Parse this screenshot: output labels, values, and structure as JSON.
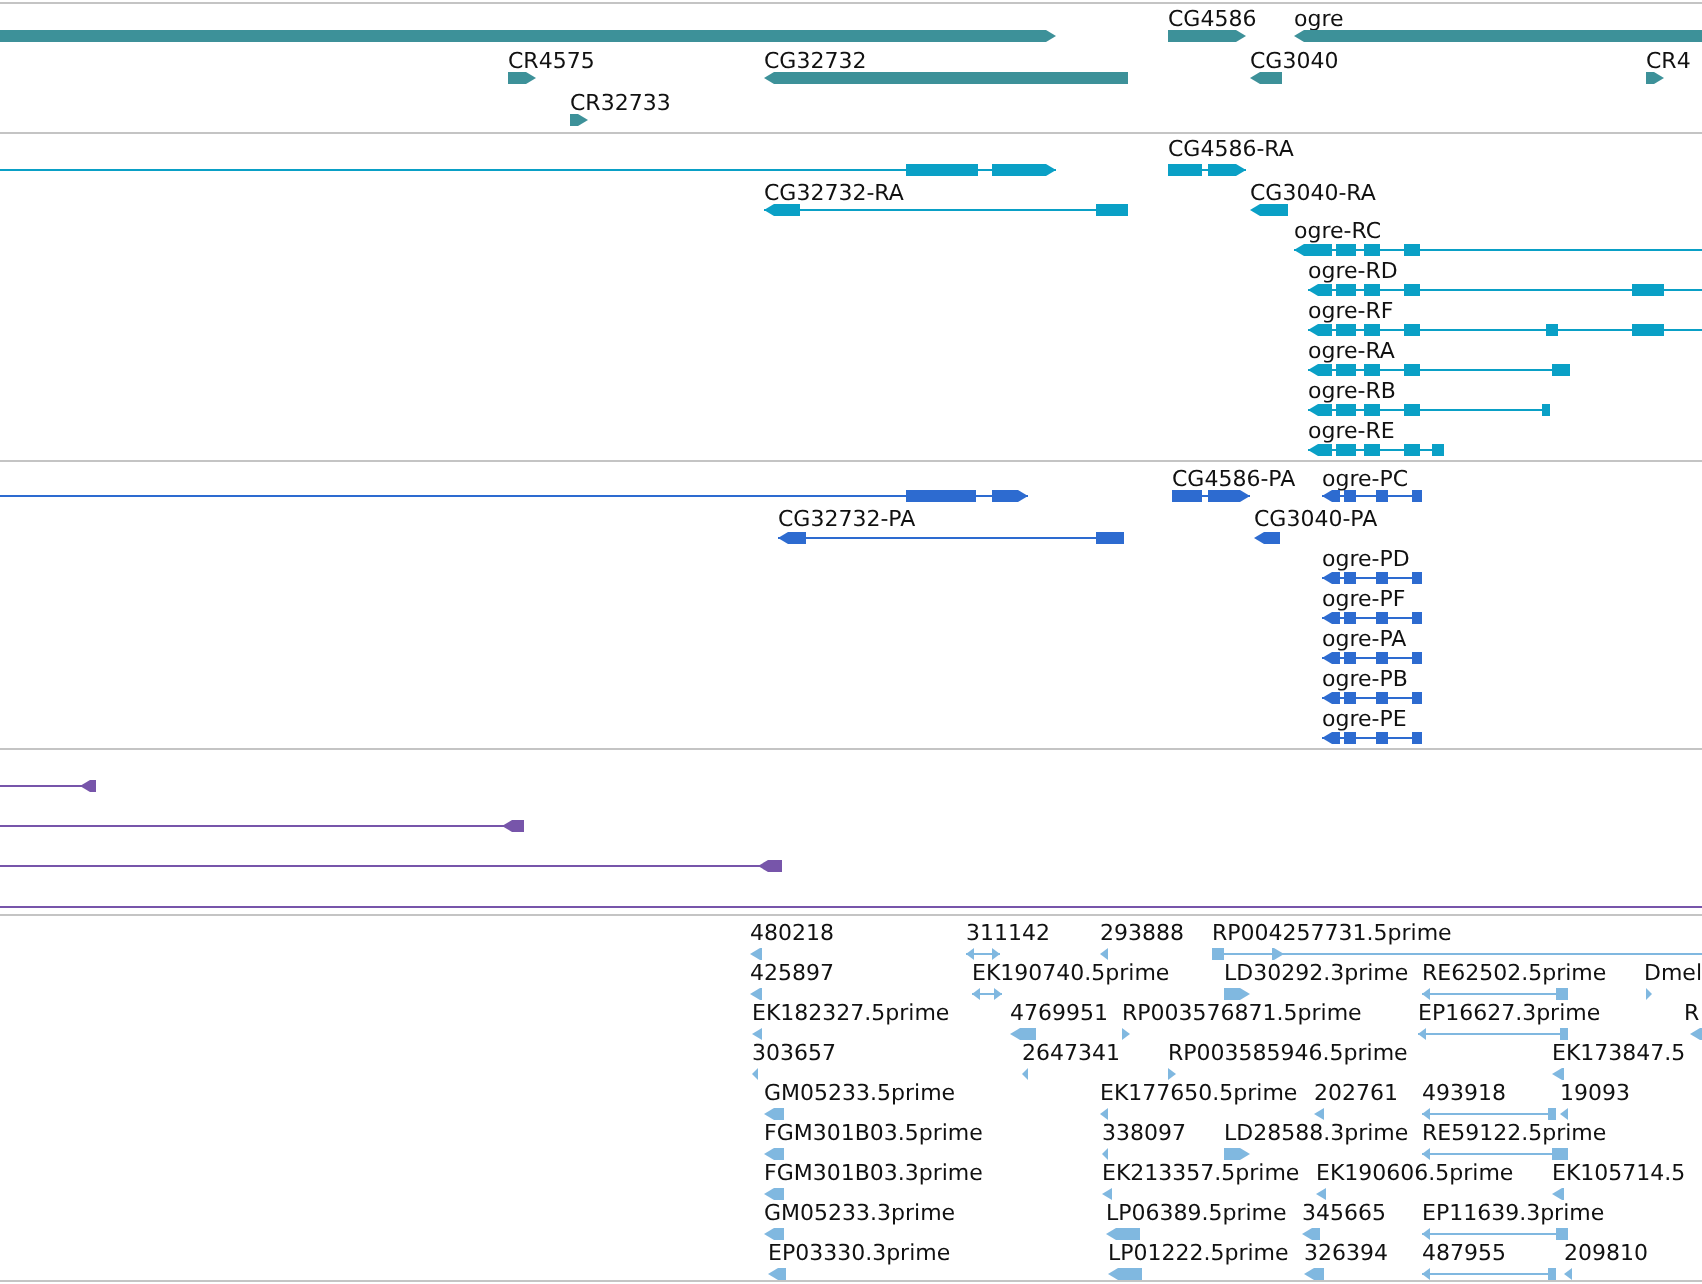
{
  "tracks": [
    {
      "kind": "gene",
      "features": [
        {
          "label": "CG4586"
        },
        {
          "label": "ogre"
        },
        {
          "label": "CR4575"
        },
        {
          "label": "CG32732"
        },
        {
          "label": "CG3040"
        },
        {
          "label": "CR4"
        },
        {
          "label": "CR32733"
        }
      ]
    },
    {
      "kind": "transcript",
      "features": [
        {
          "label": "CG4586-RA"
        },
        {
          "label": "CG32732-RA"
        },
        {
          "label": "CG3040-RA"
        },
        {
          "label": "ogre-RC"
        },
        {
          "label": "ogre-RD"
        },
        {
          "label": "ogre-RF"
        },
        {
          "label": "ogre-RA"
        },
        {
          "label": "ogre-RB"
        },
        {
          "label": "ogre-RE"
        }
      ]
    },
    {
      "kind": "protein",
      "features": [
        {
          "label": "CG4586-PA"
        },
        {
          "label": "ogre-PC"
        },
        {
          "label": "CG32732-PA"
        },
        {
          "label": "CG3040-PA"
        },
        {
          "label": "ogre-PD"
        },
        {
          "label": "ogre-PF"
        },
        {
          "label": "ogre-PA"
        },
        {
          "label": "ogre-PB"
        },
        {
          "label": "ogre-PE"
        }
      ]
    },
    {
      "kind": "match"
    },
    {
      "kind": "est",
      "features": [
        {
          "label": "480218"
        },
        {
          "label": "311142"
        },
        {
          "label": "293888"
        },
        {
          "label": "RP004257731.5prime"
        },
        {
          "label": "425897"
        },
        {
          "label": "EK190740.5prime"
        },
        {
          "label": "LD30292.3prime"
        },
        {
          "label": "RE62502.5prime"
        },
        {
          "label": "Dmel"
        },
        {
          "label": "EK182327.5prime"
        },
        {
          "label": "4769951"
        },
        {
          "label": "RP003576871.5prime"
        },
        {
          "label": "EP16627.3prime"
        },
        {
          "label": "R"
        },
        {
          "label": "303657"
        },
        {
          "label": "2647341"
        },
        {
          "label": "RP003585946.5prime"
        },
        {
          "label": "EK173847.5"
        },
        {
          "label": "GM05233.5prime"
        },
        {
          "label": "EK177650.5prime"
        },
        {
          "label": "202761"
        },
        {
          "label": "493918"
        },
        {
          "label": "19093"
        },
        {
          "label": "FGM301B03.5prime"
        },
        {
          "label": "338097"
        },
        {
          "label": "LD28588.3prime"
        },
        {
          "label": "RE59122.5prime"
        },
        {
          "label": "FGM301B03.3prime"
        },
        {
          "label": "EK213357.5prime"
        },
        {
          "label": "EK190606.5prime"
        },
        {
          "label": "EK105714.5"
        },
        {
          "label": "GM05233.3prime"
        },
        {
          "label": "LP06389.5prime"
        },
        {
          "label": "345665"
        },
        {
          "label": "EP11639.3prime"
        },
        {
          "label": "EP03330.3prime"
        },
        {
          "label": "LP01222.5prime"
        },
        {
          "label": "326394"
        },
        {
          "label": "487955"
        },
        {
          "label": "209810"
        }
      ]
    }
  ]
}
